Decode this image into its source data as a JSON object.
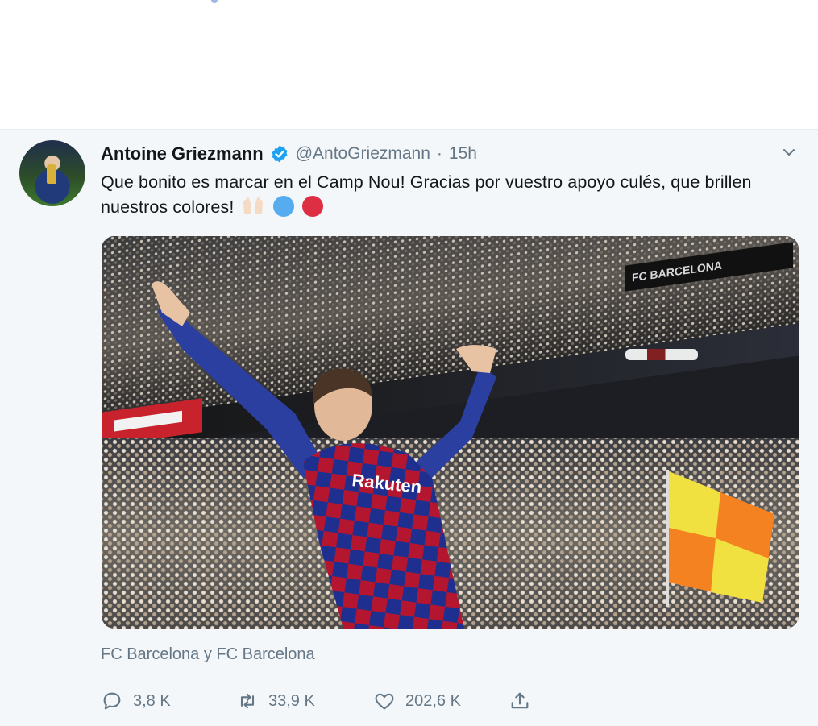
{
  "tweet": {
    "author_name": "Antoine Griezmann",
    "handle": "@AntoGriezmann",
    "separator": "·",
    "time": "15h",
    "text": "Que bonito es marcar en el Camp Nou! Gracias por vuestro apoyo culés, que brillen nuestros colores!",
    "emojis": [
      "raising-hands-emoji",
      "blue-circle-emoji",
      "red-circle-emoji"
    ],
    "photo_sponsor_text": "FC BARCELONA",
    "shirt_sponsor_text": "Rakuten",
    "tagged": "FC Barcelona y FC Barcelona",
    "actions": {
      "replies": "3,8 K",
      "retweets": "33,9 K",
      "likes": "202,6 K"
    }
  },
  "icons": {
    "verified": "verified-badge-icon",
    "chevron": "chevron-down-icon",
    "reply": "reply-icon",
    "retweet": "retweet-icon",
    "like": "heart-icon",
    "share": "share-icon"
  },
  "colors": {
    "verified_blue": "#1da1f2",
    "muted_text": "#657786",
    "primary_text": "#14171a",
    "background": "#f4f7f9",
    "blue_emoji": "#55acee",
    "red_emoji": "#dd2e44"
  }
}
